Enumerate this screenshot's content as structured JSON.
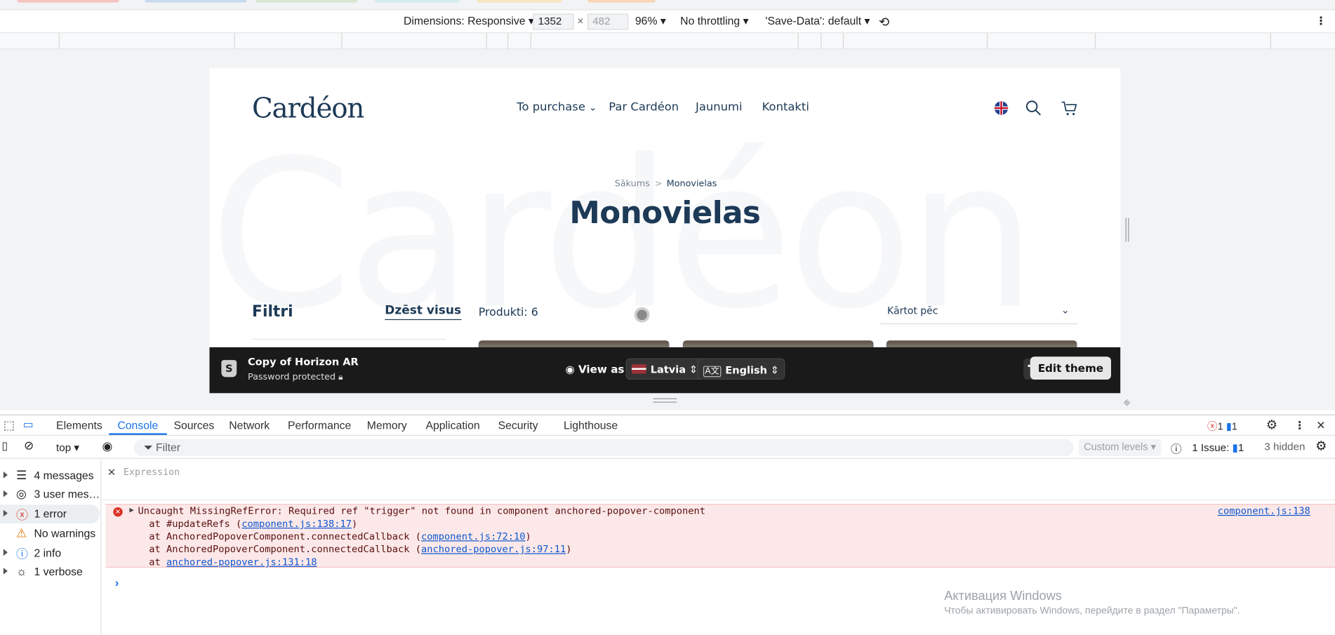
{
  "toolbar": {
    "dimensions_label": "Dimensions: Responsive",
    "width_value": "1352",
    "times": "×",
    "height_value": "482",
    "zoom": "96%",
    "throttling": "No throttling",
    "save_data": "'Save-Data': default"
  },
  "site": {
    "logo": "Cardéon",
    "nav": [
      "To purchase",
      "Par Cardéon",
      "Jaunumi",
      "Kontakti"
    ],
    "watermark_text": "Cardéon",
    "breadcrumb_home": "Sākums",
    "breadcrumb_sep": ">",
    "breadcrumb_current": "Monovielas",
    "page_title": "Monovielas",
    "filters_label": "Filtri",
    "clear_all": "Dzēst visus",
    "product_count": "Produkti: 6",
    "sort_label": "Kārtot pēc",
    "preview_bar": {
      "store_name": "Copy of Horizon AR",
      "password": "Password protected",
      "view_as": "View as",
      "country": "Latvia",
      "language": "English",
      "edit_theme": "Edit theme"
    }
  },
  "devtools": {
    "tabs": [
      "Elements",
      "Console",
      "Sources",
      "Network",
      "Performance",
      "Memory",
      "Application",
      "Security",
      "Lighthouse"
    ],
    "active_tab": "Console",
    "error_count": "1",
    "message_count": "1",
    "context": "top",
    "filter_placeholder": "Filter",
    "levels": "Custom levels",
    "issues_label": "1 Issue:",
    "issues_count": "1",
    "hidden": "3 hidden",
    "sidebar": [
      "4 messages",
      "3 user mes…",
      "1 error",
      "No warnings",
      "2 info",
      "1 verbose"
    ],
    "expression_placeholder": "Expression",
    "error": {
      "message": "Uncaught MissingRefError: Required ref \"trigger\" not found in component anchored-popover-component",
      "source": "component.js:138",
      "stack": [
        {
          "prefix": "at #updateRefs (",
          "link": "component.js:138:17",
          "suffix": ")"
        },
        {
          "prefix": "at AnchoredPopoverComponent.connectedCallback (",
          "link": "component.js:72:10",
          "suffix": ")"
        },
        {
          "prefix": "at AnchoredPopoverComponent.connectedCallback (",
          "link": "anchored-popover.js:97:11",
          "suffix": ")"
        },
        {
          "prefix": "at ",
          "link": "anchored-popover.js:131:18",
          "suffix": ""
        }
      ]
    },
    "prompt": "›"
  },
  "windows": {
    "line1": "Активация Windows",
    "line2": "Чтобы активировать Windows, перейдите в раздел \"Параметры\"."
  },
  "colors": {
    "accent": "#1a73e8",
    "brand": "#1d3a57",
    "error_bg": "#fce8e8"
  }
}
